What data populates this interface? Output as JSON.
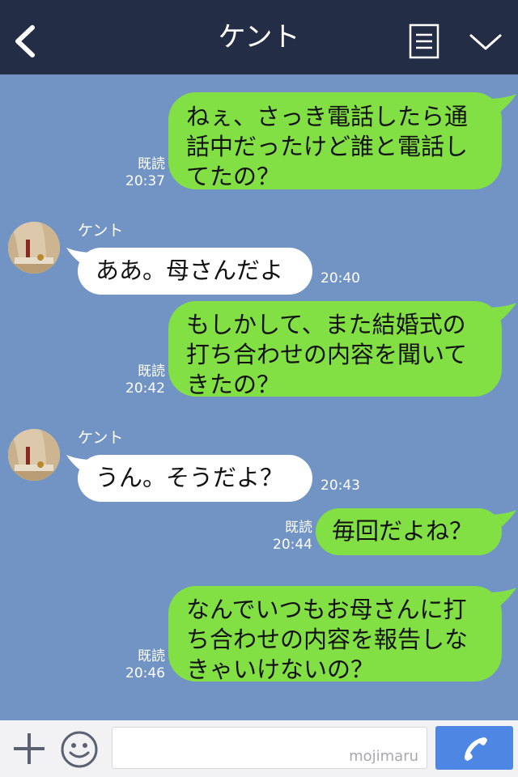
{
  "header": {
    "title": "ケント",
    "icons": {
      "back": "chevron-left-icon",
      "notes": "notes-icon",
      "menu": "chevron-down-icon"
    }
  },
  "colors": {
    "header_bg": "#232d45",
    "chat_bg": "#7294c5",
    "my_bubble": "#83e044",
    "their_bubble": "#ffffff",
    "send_button": "#4d86e3"
  },
  "messages": [
    {
      "sender": "me",
      "lines": [
        "ねぇ、さっき電話したら通",
        "話中だったけど誰と電話し",
        "てたの？"
      ],
      "read": "既読",
      "time": "20:37"
    },
    {
      "sender": "them",
      "name": "ケント",
      "lines": [
        "ああ。母さんだよ"
      ],
      "time": "20:40"
    },
    {
      "sender": "me",
      "lines": [
        "もしかして、また結婚式の",
        "打ち合わせの内容を聞いて",
        "きたの？"
      ],
      "read": "既読",
      "time": "20:42"
    },
    {
      "sender": "them",
      "name": "ケント",
      "lines": [
        "うん。そうだよ？"
      ],
      "time": "20:43"
    },
    {
      "sender": "me",
      "lines": [
        "毎回だよね？"
      ],
      "read": "既読",
      "time": "20:44"
    },
    {
      "sender": "me",
      "lines": [
        "なんでいつもお母さんに打",
        "ち合わせの内容を報告しな",
        "きゃいけないの？"
      ],
      "read": "既読",
      "time": "20:46"
    }
  ],
  "footer": {
    "icons": {
      "add": "plus-icon",
      "emoji": "smiley-icon",
      "call": "phone-icon"
    },
    "input_value": "",
    "watermark": "mojimaru"
  }
}
